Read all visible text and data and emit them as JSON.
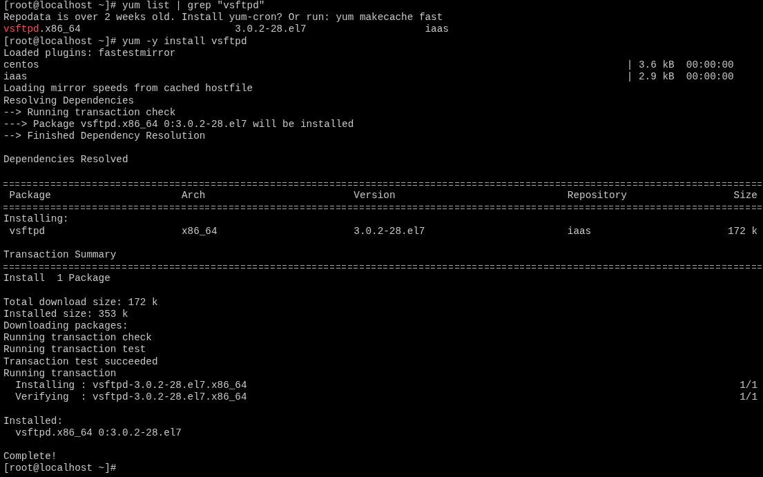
{
  "terminal": {
    "lines": [
      {
        "kind": "text",
        "text": "[root@localhost ~]# yum list | grep \"vsftpd\""
      },
      {
        "kind": "text",
        "text": "Repodata is over 2 weeks old. Install yum-cron? Or run: yum makecache fast"
      },
      {
        "kind": "grep_result",
        "match": "vsftpd",
        "rest": ".x86_64",
        "version": "3.0.2-28.el7",
        "repo": "iaas"
      },
      {
        "kind": "text",
        "text": "[root@localhost ~]# yum -y install vsftpd"
      },
      {
        "kind": "text",
        "text": "Loaded plugins: fastestmirror"
      },
      {
        "kind": "repo_status",
        "name": "centos",
        "size": "| 3.6 kB",
        "time": "00:00:00"
      },
      {
        "kind": "repo_status",
        "name": "iaas",
        "size": "| 2.9 kB",
        "time": "00:00:00"
      },
      {
        "kind": "text",
        "text": "Loading mirror speeds from cached hostfile"
      },
      {
        "kind": "text",
        "text": "Resolving Dependencies"
      },
      {
        "kind": "text",
        "text": "--> Running transaction check"
      },
      {
        "kind": "text",
        "text": "---> Package vsftpd.x86_64 0:3.0.2-28.el7 will be installed"
      },
      {
        "kind": "text",
        "text": "--> Finished Dependency Resolution"
      },
      {
        "kind": "blank"
      },
      {
        "kind": "text",
        "text": "Dependencies Resolved"
      },
      {
        "kind": "blank"
      },
      {
        "kind": "rule"
      },
      {
        "kind": "table_header",
        "cells": [
          "Package",
          "Arch",
          "Version",
          "Repository",
          "Size"
        ]
      },
      {
        "kind": "rule"
      },
      {
        "kind": "text",
        "text": "Installing:"
      },
      {
        "kind": "table_row",
        "cells": [
          "vsftpd",
          "x86_64",
          "3.0.2-28.el7",
          "iaas",
          "172 k"
        ]
      },
      {
        "kind": "blank"
      },
      {
        "kind": "text",
        "text": "Transaction Summary"
      },
      {
        "kind": "rule"
      },
      {
        "kind": "text",
        "text": "Install  1 Package"
      },
      {
        "kind": "blank"
      },
      {
        "kind": "text",
        "text": "Total download size: 172 k"
      },
      {
        "kind": "text",
        "text": "Installed size: 353 k"
      },
      {
        "kind": "text",
        "text": "Downloading packages:"
      },
      {
        "kind": "text",
        "text": "Running transaction check"
      },
      {
        "kind": "text",
        "text": "Running transaction test"
      },
      {
        "kind": "text",
        "text": "Transaction test succeeded"
      },
      {
        "kind": "text",
        "text": "Running transaction"
      },
      {
        "kind": "step",
        "action": "Installing :",
        "package": "vsftpd-3.0.2-28.el7.x86_64",
        "count": "1/1"
      },
      {
        "kind": "step",
        "action": "Verifying  :",
        "package": "vsftpd-3.0.2-28.el7.x86_64",
        "count": "1/1"
      },
      {
        "kind": "blank"
      },
      {
        "kind": "text",
        "text": "Installed:"
      },
      {
        "kind": "indented",
        "text": "vsftpd.x86_64 0:3.0.2-28.el7"
      },
      {
        "kind": "blank"
      },
      {
        "kind": "text",
        "text": "Complete!"
      },
      {
        "kind": "text",
        "text": "[root@localhost ~]#"
      }
    ]
  }
}
